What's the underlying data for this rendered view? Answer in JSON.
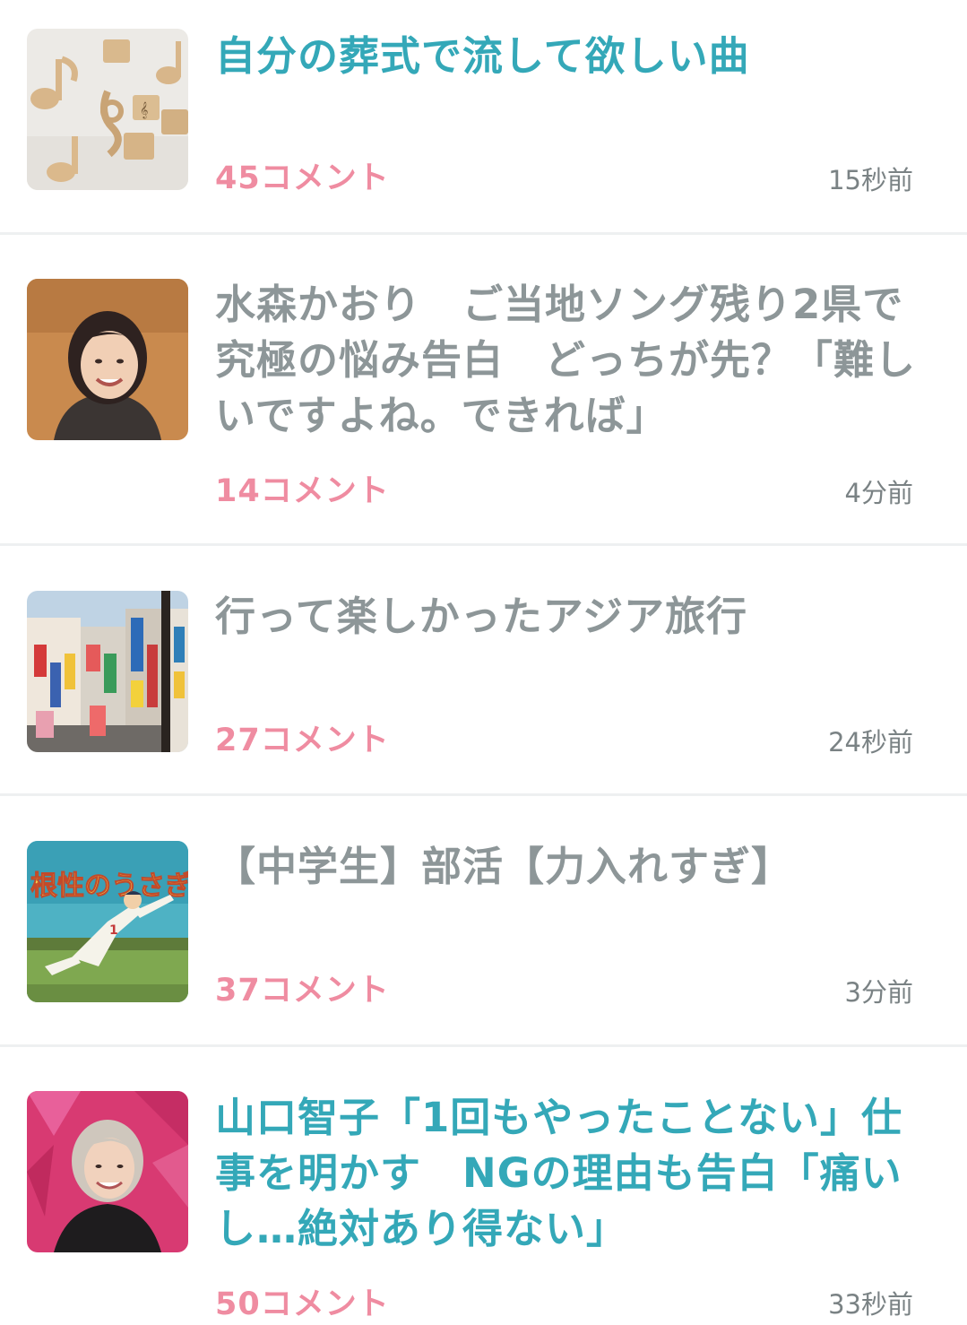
{
  "colors": {
    "title_unread": "#34a8b8",
    "title_read": "#8d9698",
    "comment_count": "#ef8ca1",
    "timestamp": "#7a8284",
    "divider": "#eef0f1"
  },
  "topics": [
    {
      "title": "自分の葬式で流して欲しい曲",
      "comments": "45コメント",
      "time": "15秒前",
      "read": false,
      "thumbnail": "music-notes-image"
    },
    {
      "title": "水森かおり　ご当地ソング残り2県で究極の悩み告白　どっちが先？「難しいですよね。できれば」",
      "comments": "14コメント",
      "time": "4分前",
      "read": true,
      "thumbnail": "woman-portrait-image"
    },
    {
      "title": "行って楽しかったアジア旅行",
      "comments": "27コメント",
      "time": "24秒前",
      "read": true,
      "thumbnail": "asian-street-signs-image"
    },
    {
      "title": "【中学生】部活【力入れすぎ】",
      "comments": "37コメント",
      "time": "3分前",
      "read": true,
      "thumbnail": "baseball-anime-image"
    },
    {
      "title": "山口智子「1回もやったことない」仕事を明かす　NGの理由も告白「痛いし…絶対あり得ない」",
      "comments": "50コメント",
      "time": "33秒前",
      "read": false,
      "thumbnail": "woman-pink-background-image"
    }
  ]
}
